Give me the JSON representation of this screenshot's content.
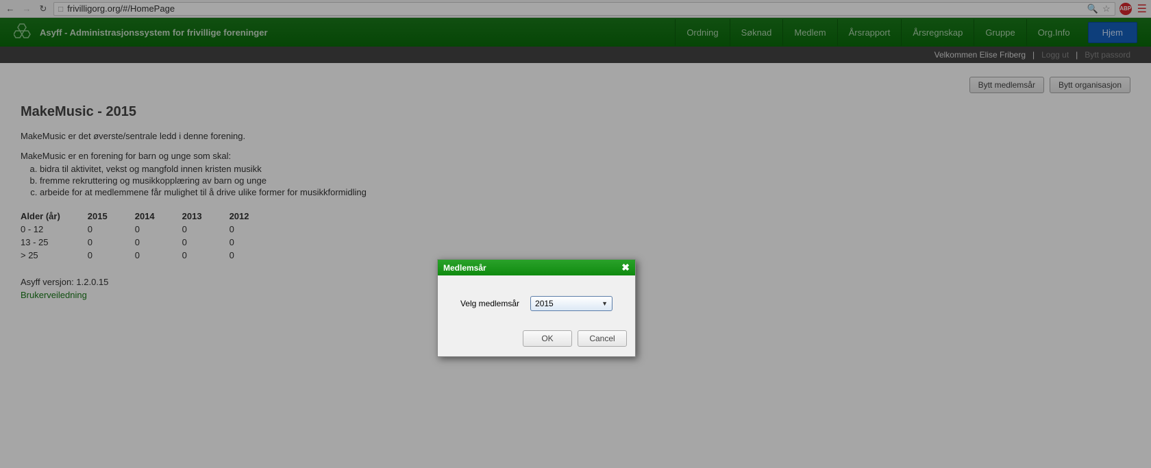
{
  "browser": {
    "url": "frivilligorg.org/#/HomePage"
  },
  "header": {
    "app_title": "Asyff - Administrasjonssystem for frivillige foreninger",
    "nav": [
      {
        "label": "Ordning"
      },
      {
        "label": "Søknad"
      },
      {
        "label": "Medlem"
      },
      {
        "label": "Årsrapport"
      },
      {
        "label": "Årsregnskap"
      },
      {
        "label": "Gruppe"
      },
      {
        "label": "Org.Info"
      }
    ],
    "nav_active": "Hjem"
  },
  "subbar": {
    "welcome": "Velkommen Elise Friberg",
    "logout": "Logg ut",
    "change_pw": "Bytt passord",
    "sep": "|"
  },
  "buttons": {
    "bytt_medlemsar": "Bytt medlemsår",
    "bytt_org": "Bytt organisasjon"
  },
  "page": {
    "title": "MakeMusic - 2015",
    "intro": "MakeMusic er det øverste/sentrale ledd i denne forening.",
    "desc": "MakeMusic er en forening for barn og unge som skal:",
    "items": [
      "bidra til aktivitet, vekst og mangfold innen kristen musikk",
      "fremme rekruttering og musikkopplæring av barn og unge",
      "arbeide for at medlemmene får mulighet til å drive ulike former for musikkformidling"
    ],
    "table": {
      "headers": [
        "Alder (år)",
        "2015",
        "2014",
        "2013",
        "2012"
      ],
      "rows": [
        [
          "0 - 12",
          "0",
          "0",
          "0",
          "0"
        ],
        [
          "13 - 25",
          "0",
          "0",
          "0",
          "0"
        ],
        [
          "> 25",
          "0",
          "0",
          "0",
          "0"
        ]
      ]
    },
    "version": "Asyff versjon: 1.2.0.15",
    "guide": "Brukerveiledning"
  },
  "dialog": {
    "title": "Medlemsår",
    "label": "Velg medlemsår",
    "selected": "2015",
    "ok": "OK",
    "cancel": "Cancel"
  }
}
